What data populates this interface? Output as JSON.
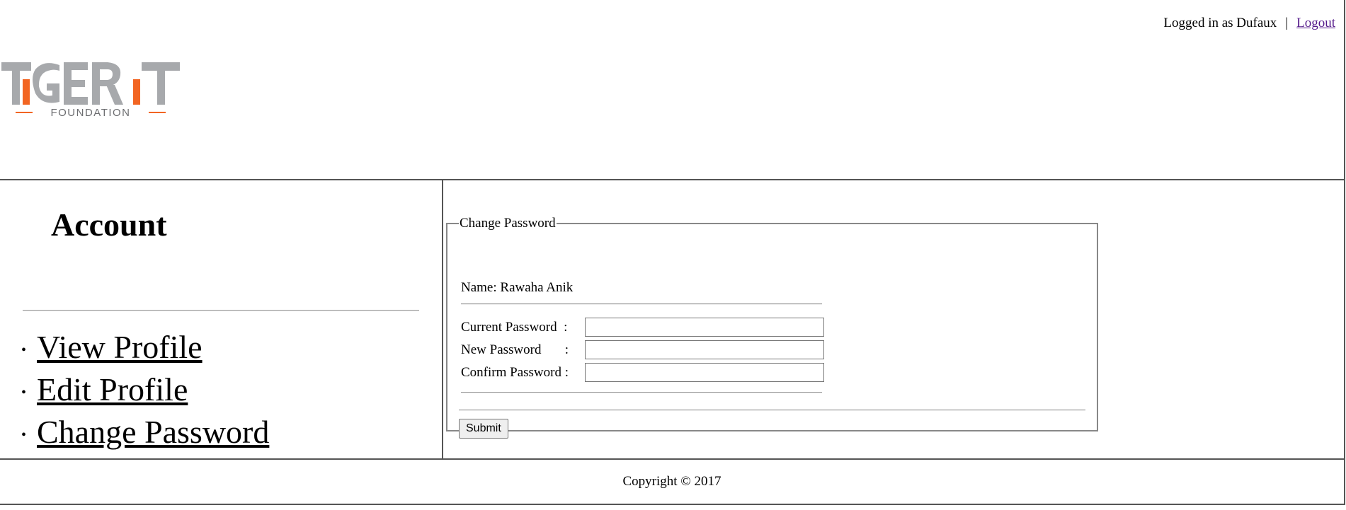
{
  "header": {
    "logged_in_text": "Logged in as Dufaux",
    "separator": "|",
    "logout_label": "Logout",
    "logo": {
      "name": "TiGER iT",
      "subtitle": "FOUNDATION",
      "colors": {
        "gray": "#a7a9ac",
        "orange": "#f26522"
      }
    }
  },
  "sidebar": {
    "title": "Account",
    "menu": [
      {
        "label": "View Profile"
      },
      {
        "label": "Edit Profile"
      },
      {
        "label": "Change Password"
      }
    ]
  },
  "form": {
    "legend": "Change Password",
    "name_line": "Name: Rawaha Anik",
    "fields": [
      {
        "label": "Current Password  :",
        "value": ""
      },
      {
        "label": "New Password       :",
        "value": ""
      },
      {
        "label": "Confirm Password :",
        "value": ""
      }
    ],
    "submit_label": "Submit"
  },
  "footer": {
    "copyright": "Copyright © 2017"
  }
}
